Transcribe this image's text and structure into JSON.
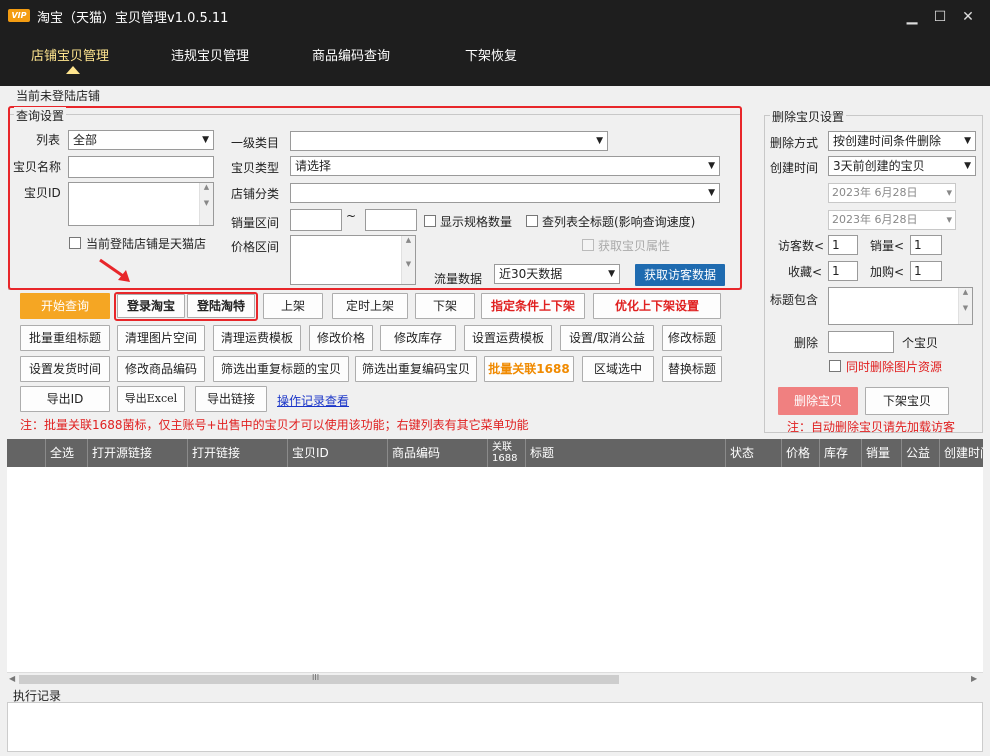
{
  "app": {
    "vip_badge": "VIP",
    "title": "淘宝（天猫）宝贝管理v1.0.5.11",
    "minimize": "▁",
    "maximize": "☐",
    "close": "✕"
  },
  "nav": {
    "tabs": [
      {
        "label": "店铺宝贝管理",
        "active": true
      },
      {
        "label": "违规宝贝管理"
      },
      {
        "label": "商品编码查询"
      },
      {
        "label": "下架恢复"
      }
    ]
  },
  "status_text": "当前未登陆店铺",
  "query": {
    "legend": "查询设置",
    "list_label": "列表",
    "list_value": "全部",
    "name_label": "宝贝名称",
    "name_value": "",
    "id_label": "宝贝ID",
    "id_value": "",
    "tmall_checkbox": "当前登陆店铺是天猫店",
    "cat1_label": "一级类目",
    "cat1_value": "",
    "type_label": "宝贝类型",
    "type_value": "请选择",
    "shopcat_label": "店铺分类",
    "shopcat_value": "",
    "sales_label": "销量区间",
    "sales_tilde": "~",
    "price_label": "价格区间",
    "show_spec": "显示规格数量",
    "full_title": "查列表全标题(影响查询速度)",
    "get_attr": "获取宝贝属性",
    "traffic_label": "流量数据",
    "traffic_value": "近30天数据",
    "get_visitor_btn": "获取访客数据"
  },
  "actions": {
    "start_query": "开始查询",
    "login_taobao": "登录淘宝",
    "login_tmall": "登陆淘特",
    "list_up": "上架",
    "timed_up": "定时上架",
    "list_down": "下架",
    "cond_updown": "指定条件上下架",
    "optimize_updown": "优化上下架设置",
    "row2": [
      "批量重组标题",
      "清理图片空间",
      "清理运费模板",
      "修改价格",
      "修改库存",
      "设置运费模板",
      "设置/取消公益",
      "修改标题"
    ],
    "row3": [
      "设置发货时间",
      "修改商品编码",
      "筛选出重复标题的宝贝",
      "筛选出重复编码宝贝",
      "批量关联1688",
      "区域选中",
      "替换标题"
    ],
    "export_id": "导出ID",
    "export_excel": "导出Excel",
    "export_link": "导出链接",
    "op_log": "操作记录查看"
  },
  "note_main": "注：批量关联1688菌标，仅主账号+出售中的宝贝才可以使用该功能；右键列表有其它菜单功能",
  "delete": {
    "legend": "删除宝贝设置",
    "method_label": "删除方式",
    "method_value": "按创建时间条件删除",
    "ctime_label": "创建时间",
    "ctime_value": "3天前创建的宝贝",
    "date1": "2023年  6月28日",
    "date2": "2023年  6月28日",
    "visitors_label": "访客数<",
    "visitors_value": "1",
    "sales_label": "销量<",
    "sales_value": "1",
    "fav_label": "收藏<",
    "fav_value": "1",
    "cart_label": "加购<",
    "cart_value": "1",
    "title_contains": "标题包含",
    "delete_label": "删除",
    "delete_unit": "个宝贝",
    "delete_images": "同时删除图片资源",
    "delete_btn": "删除宝贝",
    "offshelf_btn": "下架宝贝",
    "note": "注：自动删除宝贝请先加载访客"
  },
  "table": {
    "columns": [
      {
        "label": "全选"
      },
      {
        "label": "打开源链接"
      },
      {
        "label": "打开链接"
      },
      {
        "label": "宝贝ID"
      },
      {
        "label": "商品编码"
      },
      {
        "label": "关联1688"
      },
      {
        "label": "标题"
      },
      {
        "label": "状态"
      },
      {
        "label": "价格"
      },
      {
        "label": "库存"
      },
      {
        "label": "销量"
      },
      {
        "label": "公益"
      },
      {
        "label": "创建时间"
      }
    ]
  },
  "log_label": "执行记录",
  "hscroll_grip": "III",
  "colors": {
    "accent_red": "#e8262a",
    "start_btn": "#f5a623",
    "visitor_btn": "#1f6bb0",
    "delete_btn": "#f08080"
  }
}
